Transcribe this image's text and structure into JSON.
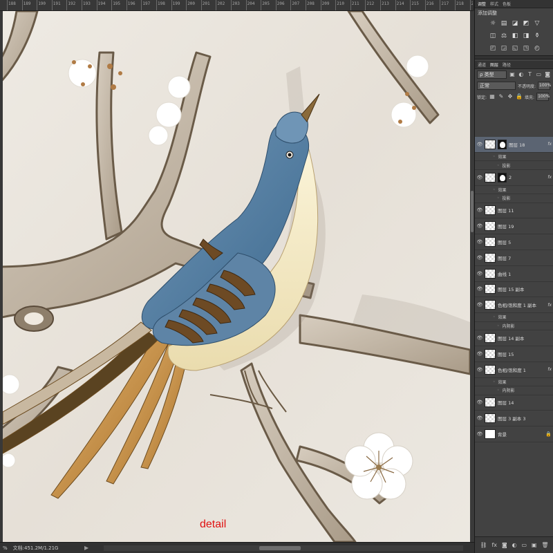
{
  "ruler": {
    "labels": [
      "188",
      "189",
      "190",
      "191",
      "192",
      "193",
      "194",
      "195",
      "196",
      "197",
      "198",
      "199",
      "200",
      "201",
      "202",
      "203",
      "204",
      "205",
      "206",
      "207",
      "208",
      "209",
      "210",
      "211",
      "212",
      "213",
      "214",
      "215",
      "216",
      "217",
      "218",
      "219"
    ]
  },
  "canvas": {
    "caption": "detail"
  },
  "status": {
    "zoom": "%",
    "doc_info": "文档:451.2M/1.21G",
    "arrow": "▶"
  },
  "panels": {
    "top_tabs": [
      "调整",
      "样式",
      "色板"
    ],
    "adjust_title": "添加调整",
    "adjust_icons": [
      "☼",
      "▤",
      "◪",
      "◩",
      "▽",
      "◫",
      "⚖",
      "◧",
      "◨",
      "⚱",
      "◰",
      "◲",
      "◱",
      "◳",
      "◴"
    ],
    "layer_tabs": [
      "通道",
      "图层",
      "路径"
    ],
    "filter_kind": "ρ 类型",
    "blend_mode": "正常",
    "opacity_label": "不透明度:",
    "opacity_value": "100%",
    "lock_label": "锁定:",
    "fill_label": "填充:",
    "fill_value": "100%",
    "eye": "👁",
    "fx": "fx",
    "effect_label": "效果",
    "drop_shadow": "投影",
    "inner_shadow": "内阴影",
    "layers": [
      {
        "name": "图层 18",
        "fx": true,
        "mask": true,
        "selected": true,
        "effects": [
          "效果",
          "投影"
        ]
      },
      {
        "name": "2",
        "fx": true,
        "mask": true,
        "selected": false,
        "effects": [
          "效果",
          "投影"
        ]
      },
      {
        "name": "图层 11"
      },
      {
        "name": "图层 19"
      },
      {
        "name": "图层 5"
      },
      {
        "name": "图层 7"
      },
      {
        "name": "曲线 1"
      },
      {
        "name": "图层 15 副本"
      },
      {
        "name": "色相/饱和度 1 副本",
        "fx": true,
        "effects": [
          "效果",
          "内阴影"
        ]
      },
      {
        "name": "图层 14 副本"
      },
      {
        "name": "图层 15"
      },
      {
        "name": "色相/饱和度 1",
        "fx": true,
        "effects": [
          "效果",
          "内阴影"
        ]
      },
      {
        "name": "图层 14"
      },
      {
        "name": "图层 3 副本 3"
      },
      {
        "name": "背景",
        "white": true,
        "locked": true
      }
    ],
    "footer_icons": [
      "⛓",
      "fx",
      "◙",
      "◐",
      "▭",
      "▣",
      "🗑"
    ]
  }
}
